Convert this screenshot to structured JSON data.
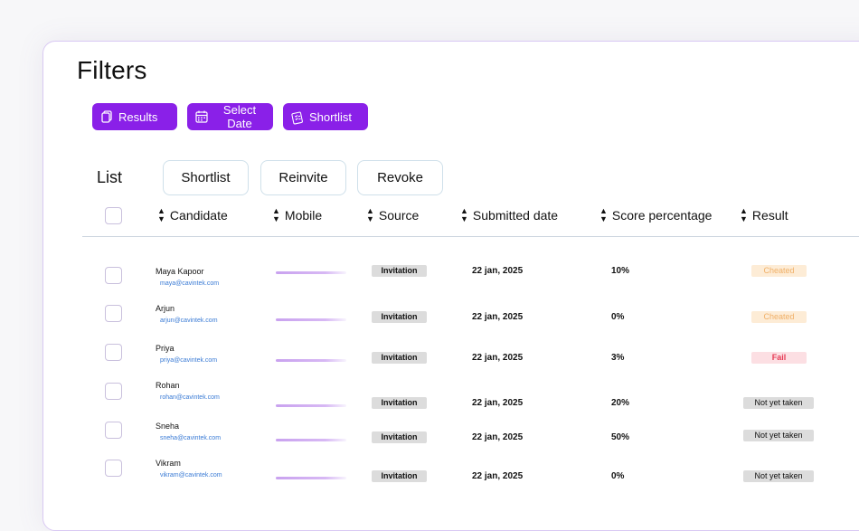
{
  "page": {
    "title": "Filters"
  },
  "filters": {
    "results_label": "Results",
    "select_date_label": "Select Date",
    "shortlist_label": "Shortlist"
  },
  "list": {
    "label": "List",
    "actions": {
      "shortlist": "Shortlist",
      "reinvite": "Reinvite",
      "revoke": "Revoke"
    }
  },
  "table": {
    "columns": {
      "candidate": "Candidate",
      "mobile": "Mobile",
      "source": "Source",
      "submitted": "Submitted date",
      "score": "Score percentage",
      "result": "Result"
    },
    "rows": [
      {
        "name": "Maya Kapoor",
        "email": "maya@cavintek.com",
        "source": "Invitation",
        "date": "22 jan, 2025",
        "score": "10%",
        "result": "Cheated",
        "result_type": "cheated"
      },
      {
        "name": "Arjun",
        "email": "arjun@cavintek.com",
        "source": "Invitation",
        "date": "22 jan, 2025",
        "score": "0%",
        "result": "Cheated",
        "result_type": "cheated"
      },
      {
        "name": "Priya",
        "email": "priya@cavintek.com",
        "source": "Invitation",
        "date": "22 jan, 2025",
        "score": "3%",
        "result": "Fail",
        "result_type": "fail"
      },
      {
        "name": "Rohan",
        "email": "rohan@cavintek.com",
        "source": "Invitation",
        "date": "22 jan, 2025",
        "score": "20%",
        "result": "Not yet taken",
        "result_type": "pending"
      },
      {
        "name": "Sneha",
        "email": "sneha@cavintek.com",
        "source": "Invitation",
        "date": "22 jan, 2025",
        "score": "50%",
        "result": "Not yet taken",
        "result_type": "pending"
      },
      {
        "name": "Vikram",
        "email": "vikram@cavintek.com",
        "source": "Invitation",
        "date": "22 jan, 2025",
        "score": "0%",
        "result": "Not yet taken",
        "result_type": "pending"
      }
    ]
  },
  "colors": {
    "accent": "#8a20e8",
    "email_link": "#3a7bd5"
  },
  "icons": {
    "results": "copy-icon",
    "select_date": "calendar-icon",
    "shortlist": "checklist-icon",
    "sort": "sort-icon"
  }
}
